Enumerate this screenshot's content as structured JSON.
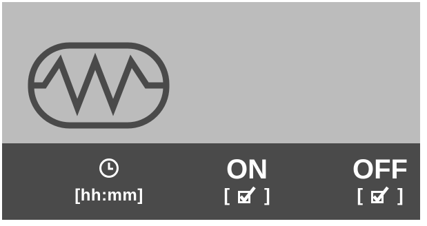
{
  "icons": {
    "heater": "heating-element-icon",
    "clock": "clock-icon",
    "checkbox": "checked-box-icon"
  },
  "colors": {
    "screen_background": "#bcbcbc",
    "bottom_bar": "#4a4a4a",
    "foreground_text": "#ffffff",
    "icon_stroke": "#4a4a4a"
  },
  "controls": {
    "time": {
      "label": "[hh:mm]"
    },
    "on": {
      "label": "ON",
      "bracket_open": "[",
      "bracket_close": "]"
    },
    "off": {
      "label": "OFF",
      "bracket_open": "[",
      "bracket_close": "]"
    }
  }
}
